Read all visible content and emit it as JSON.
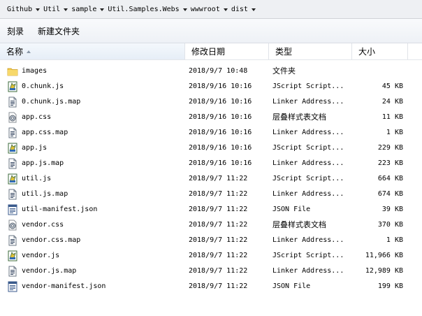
{
  "breadcrumb": [
    "Github",
    "Util",
    "sample",
    "Util.Samples.Webs",
    "wwwroot",
    "dist"
  ],
  "toolbar": {
    "burn_label": "刻录",
    "new_folder_label": "新建文件夹"
  },
  "columns": {
    "name": "名称",
    "date": "修改日期",
    "type": "类型",
    "size": "大小"
  },
  "files": [
    {
      "name": "images",
      "date": "2018/9/7 10:48",
      "type": "文件夹",
      "size": "",
      "icon": "folder-icon"
    },
    {
      "name": "0.chunk.js",
      "date": "2018/9/16 10:16",
      "type": "JScript Script...",
      "size": "45 KB",
      "icon": "jscript-file-icon"
    },
    {
      "name": "0.chunk.js.map",
      "date": "2018/9/16 10:16",
      "type": "Linker Address...",
      "size": "24 KB",
      "icon": "map-file-icon"
    },
    {
      "name": "app.css",
      "date": "2018/9/16 10:16",
      "type": "层叠样式表文档",
      "size": "11 KB",
      "icon": "css-file-icon"
    },
    {
      "name": "app.css.map",
      "date": "2018/9/16 10:16",
      "type": "Linker Address...",
      "size": "1 KB",
      "icon": "map-file-icon"
    },
    {
      "name": "app.js",
      "date": "2018/9/16 10:16",
      "type": "JScript Script...",
      "size": "229 KB",
      "icon": "jscript-file-icon"
    },
    {
      "name": "app.js.map",
      "date": "2018/9/16 10:16",
      "type": "Linker Address...",
      "size": "223 KB",
      "icon": "map-file-icon"
    },
    {
      "name": "util.js",
      "date": "2018/9/7 11:22",
      "type": "JScript Script...",
      "size": "664 KB",
      "icon": "jscript-file-icon"
    },
    {
      "name": "util.js.map",
      "date": "2018/9/7 11:22",
      "type": "Linker Address...",
      "size": "674 KB",
      "icon": "map-file-icon"
    },
    {
      "name": "util-manifest.json",
      "date": "2018/9/7 11:22",
      "type": "JSON File",
      "size": "39 KB",
      "icon": "json-file-icon"
    },
    {
      "name": "vendor.css",
      "date": "2018/9/7 11:22",
      "type": "层叠样式表文档",
      "size": "370 KB",
      "icon": "css-file-icon"
    },
    {
      "name": "vendor.css.map",
      "date": "2018/9/7 11:22",
      "type": "Linker Address...",
      "size": "1 KB",
      "icon": "map-file-icon"
    },
    {
      "name": "vendor.js",
      "date": "2018/9/7 11:22",
      "type": "JScript Script...",
      "size": "11,966 KB",
      "icon": "jscript-file-icon"
    },
    {
      "name": "vendor.js.map",
      "date": "2018/9/7 11:22",
      "type": "Linker Address...",
      "size": "12,989 KB",
      "icon": "map-file-icon"
    },
    {
      "name": "vendor-manifest.json",
      "date": "2018/9/7 11:22",
      "type": "JSON File",
      "size": "199 KB",
      "icon": "json-file-icon"
    }
  ]
}
